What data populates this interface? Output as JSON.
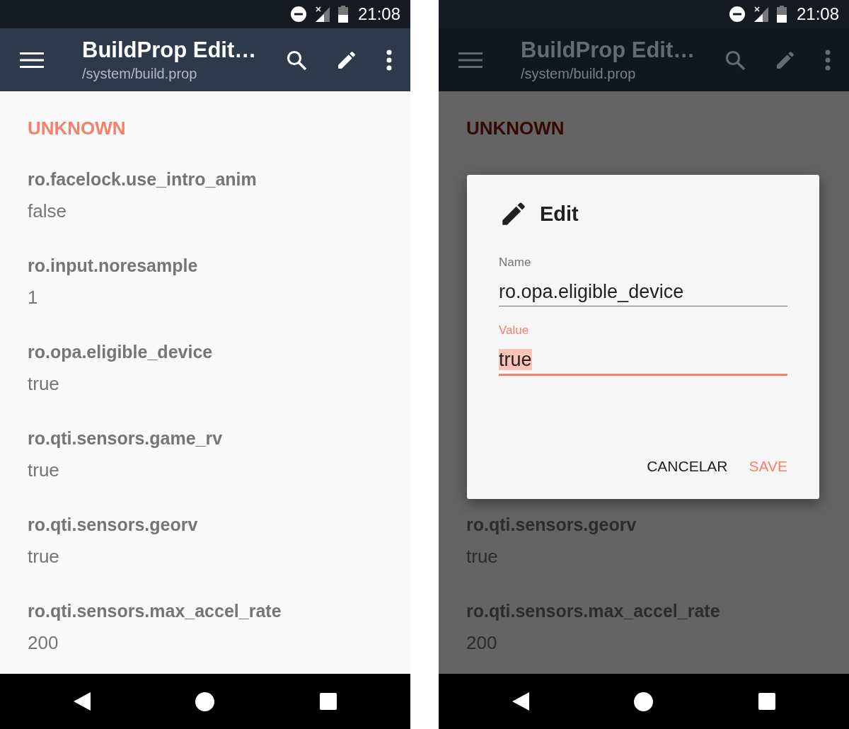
{
  "phones": [
    {
      "status_bar": {
        "time": "21:08"
      },
      "app_bar": {
        "title": "BuildProp Edit…",
        "subtitle": "/system/build.prop"
      },
      "section": "UNKNOWN",
      "dimmed": false,
      "properties": [
        {
          "name": "ro.facelock.use_intro_anim",
          "value": "false"
        },
        {
          "name": "ro.input.noresample",
          "value": "1"
        },
        {
          "name": "ro.opa.eligible_device",
          "value": "true"
        },
        {
          "name": "ro.qti.sensors.game_rv",
          "value": "true"
        },
        {
          "name": "ro.qti.sensors.georv",
          "value": "true"
        },
        {
          "name": "ro.qti.sensors.max_accel_rate",
          "value": "200"
        }
      ]
    },
    {
      "status_bar": {
        "time": "21:08"
      },
      "app_bar": {
        "title": "BuildProp Edit…",
        "subtitle": "/system/build.prop"
      },
      "section": "UNKNOWN",
      "dimmed": true,
      "properties": [
        {
          "name": "ro.qti.sensors.georv",
          "value": "true"
        },
        {
          "name": "ro.qti.sensors.max_accel_rate",
          "value": "200"
        }
      ],
      "dialog": {
        "title": "Edit",
        "fields": [
          {
            "label": "Name",
            "value": "ro.opa.eligible_device",
            "focused": false,
            "text_selected": false
          },
          {
            "label": "Value",
            "value": "true",
            "focused": true,
            "text_selected": true
          }
        ],
        "buttons": [
          {
            "label": "CANCELAR",
            "kind": "neutral"
          },
          {
            "label": "SAVE",
            "kind": "primary"
          }
        ]
      }
    }
  ]
}
